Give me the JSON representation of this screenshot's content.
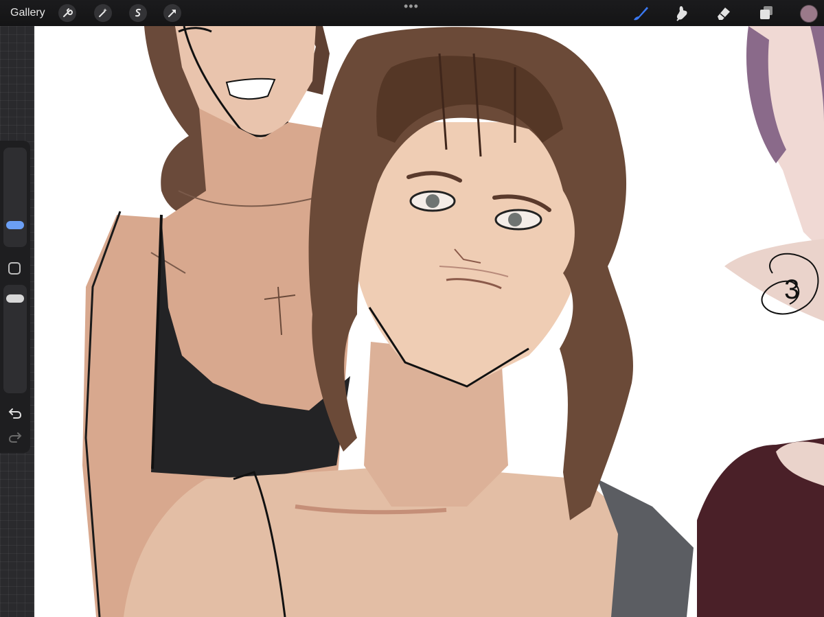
{
  "toolbar": {
    "gallery_label": "Gallery",
    "actions_icons": [
      "wrench-icon",
      "magic-wand-icon",
      "selection-icon",
      "transform-icon"
    ],
    "more_icon": "•••",
    "tools": [
      "brush-icon",
      "smudge-icon",
      "eraser-icon",
      "layers-icon"
    ],
    "active_tool": "brush",
    "current_color": "#9a7a8a",
    "active_accent": "#3a78f0"
  },
  "sidebar": {
    "brush_size": 0.25,
    "brush_opacity": 0.8,
    "icons": [
      "modify-square-icon",
      "undo-icon",
      "redo-icon"
    ]
  },
  "canvas": {
    "annotation": "3"
  }
}
